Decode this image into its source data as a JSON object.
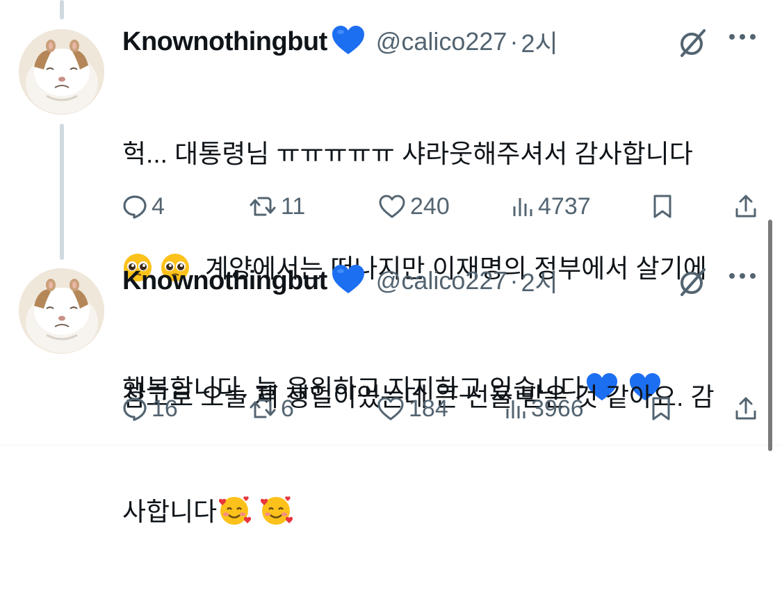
{
  "tweets": [
    {
      "author": "Knownothingbut",
      "verified_icon": "blue-heart-icon",
      "handle": "@calico227",
      "separator": "·",
      "time": "2시",
      "text_lines": [
        "헉... 대통령님 ㅠㅠㅠㅠㅠ 샤라웃해주셔서 감사합니다",
        "계양에서는 떠나지만 이재명의 정부에서 살기에",
        "행복합니다. 늘 응원하고 지지하고 있습니다"
      ],
      "emojis": [
        "pleading-face-icon",
        "blue-heart-icon"
      ],
      "replies": "4",
      "retweets": "11",
      "likes": "240",
      "views": "4737"
    },
    {
      "author": "Knownothingbut",
      "verified_icon": "blue-heart-icon",
      "handle": "@calico227",
      "separator": "·",
      "time": "2시",
      "text_lines": [
        "참고로 오늘 제 생일이었는데 큰 선물 받은 것 같아요. 감",
        "사합니다"
      ],
      "emojis": [
        "smiling-face-with-hearts-icon"
      ],
      "replies": "16",
      "retweets": "6",
      "likes": "184",
      "views": "3966"
    }
  ],
  "colors": {
    "text": "#0f1419",
    "secondary": "#536471",
    "thread_line": "#cfd9de",
    "heart_blue": "#1d6ff2"
  }
}
